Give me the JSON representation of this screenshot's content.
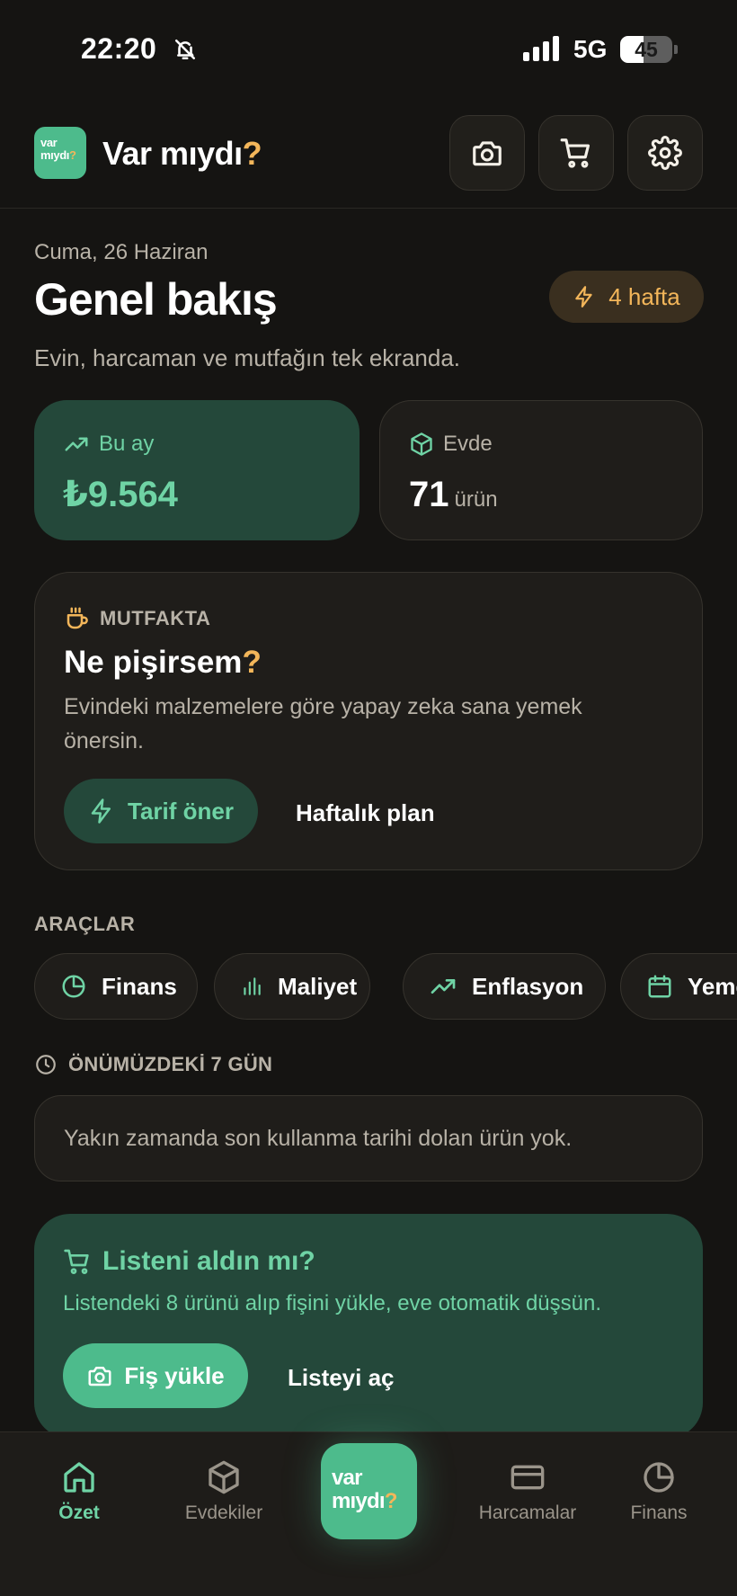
{
  "status_bar": {
    "time": "22:20",
    "network": "5G",
    "battery": "45",
    "battery_level": 0.45
  },
  "header": {
    "logo_line1": "var",
    "logo_line2": "mıydı",
    "logo_q": "?",
    "title": "Var mıydı",
    "title_q": "?"
  },
  "overview": {
    "date": "Cuma, 26 Haziran",
    "title": "Genel bakış",
    "badge": "4 hafta",
    "subtitle": "Evin, harcaman ve mutfağın tek ekranda."
  },
  "stats": {
    "month_label": "Bu ay",
    "month_value": "₺9.564",
    "home_label": "Evde",
    "home_value": "71",
    "home_unit": "ürün"
  },
  "kitchen": {
    "eyebrow": "MUTFAKTA",
    "title": "Ne pişirsem",
    "title_q": "?",
    "description": "Evindeki malzemelere göre yapay zeka sana yemek önersin.",
    "primary_button": "Tarif öner",
    "secondary_link": "Haftalık plan"
  },
  "tools": {
    "heading": "ARAÇLAR",
    "items": [
      {
        "label": "Finans",
        "icon": "pie-chart-icon"
      },
      {
        "label": "Maliyet",
        "icon": "bar-chart-icon"
      },
      {
        "label": "Enflasyon",
        "icon": "trending-up-icon"
      },
      {
        "label": "Yemek",
        "icon": "calendar-icon"
      }
    ]
  },
  "upcoming": {
    "heading": "ÖNÜMÜZDEKİ 7 GÜN",
    "empty_message": "Yakın zamanda son kullanma tarihi dolan ürün yok."
  },
  "shopping": {
    "title": "Listeni aldın mı?",
    "description": "Listendeki 8 ürünü alıp fişini yükle, eve otomatik düşsün.",
    "primary_button": "Fiş yükle",
    "secondary_link": "Listeyi aç"
  },
  "bottom_nav": {
    "items": [
      {
        "label": "Özet",
        "icon": "home-icon",
        "active": true
      },
      {
        "label": "Evdekiler",
        "icon": "box-icon"
      },
      {
        "label": "Harcamalar",
        "icon": "credit-card-icon"
      },
      {
        "label": "Finans",
        "icon": "pie-chart-icon"
      }
    ],
    "center_line1": "var",
    "center_line2": "mıydı",
    "center_q": "?"
  },
  "colors": {
    "background": "#151412",
    "accent_green": "#4dbb8c",
    "accent_green_text": "#6fd3a5",
    "card_green": "#24483a",
    "accent_amber": "#f3b65a"
  }
}
